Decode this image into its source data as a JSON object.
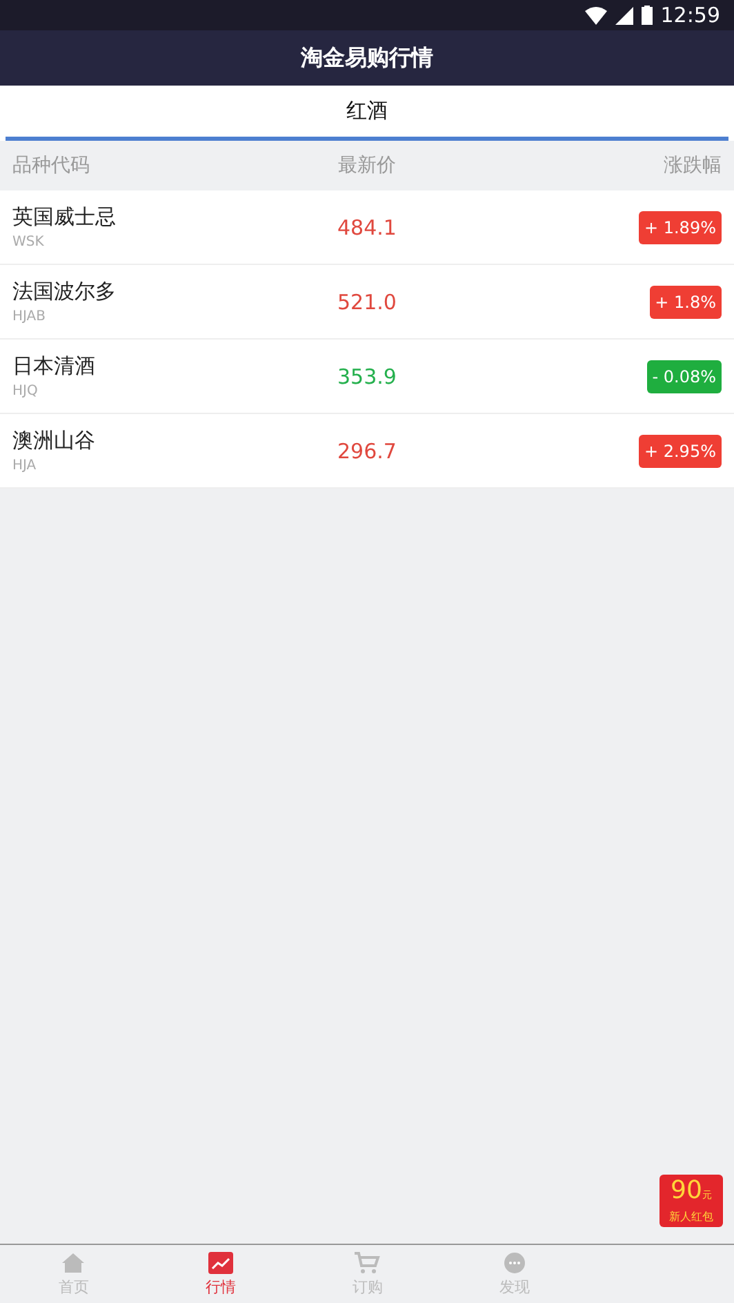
{
  "status_bar": {
    "time": "12:59"
  },
  "header": {
    "title": "淘金易购行情"
  },
  "tabs": [
    {
      "label": "红酒",
      "selected": true
    }
  ],
  "table": {
    "columns": [
      "品种代码",
      "最新价",
      "涨跌幅"
    ],
    "rows": [
      {
        "name": "英国威士忌",
        "code": "WSK",
        "price": "484.1",
        "change": "+ 1.89%",
        "kind": "up"
      },
      {
        "name": "法国波尔多",
        "code": "HJAB",
        "price": "521.0",
        "change": "+ 1.8%",
        "kind": "up"
      },
      {
        "name": "日本清酒",
        "code": "HJQ",
        "price": "353.9",
        "change": "- 0.08%",
        "kind": "down"
      },
      {
        "name": "澳洲山谷",
        "code": "HJA",
        "price": "296.7",
        "change": "+ 2.95%",
        "kind": "up"
      }
    ]
  },
  "promo": {
    "amount": "90",
    "unit": "元",
    "caption": "新人红包"
  },
  "bottom_nav": [
    {
      "label": "首页",
      "kind": "home",
      "selected": false
    },
    {
      "label": "行情",
      "kind": "chart",
      "selected": true
    },
    {
      "label": "订购",
      "kind": "cart",
      "selected": false
    },
    {
      "label": "发现",
      "kind": "discover",
      "selected": false
    }
  ]
}
